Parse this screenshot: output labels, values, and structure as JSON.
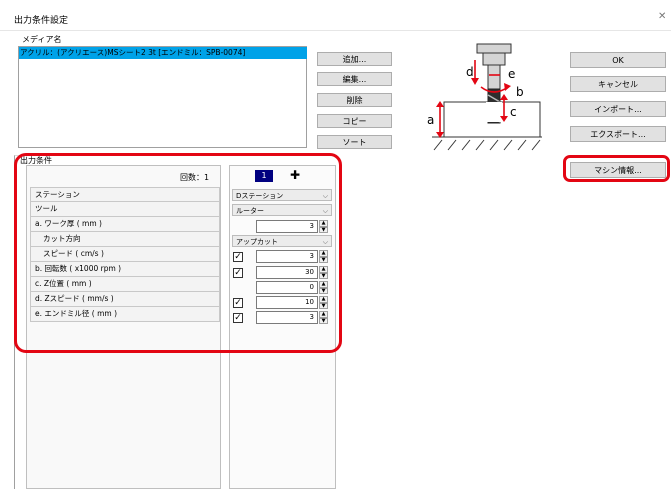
{
  "window": {
    "title": "出力条件設定",
    "close_glyph": "✕"
  },
  "media": {
    "label": "メディア名",
    "items": [
      "アクリル：(アクリエース)MSシート2 3t [エンドミル：SPB-0074]"
    ]
  },
  "buttons": {
    "add": "追加...",
    "edit": "編集...",
    "delete": "削除",
    "copy": "コピー",
    "sort": "ソート",
    "ok": "OK",
    "cancel": "キャンセル",
    "import": "インポート...",
    "export": "エクスポート...",
    "machine_info": "マシン情報..."
  },
  "diagram": {
    "icon": "end-mill-cutting-diagram-icon",
    "labels": {
      "a": "a",
      "b": "b",
      "c": "c",
      "d": "d",
      "e": "e"
    },
    "colors": {
      "arrows": "#e30613"
    }
  },
  "output": {
    "label": "出力条件",
    "count_label": "回数：1",
    "tab_number": "1",
    "add_glyph": "✚",
    "rows": [
      {
        "label": "ステーション"
      },
      {
        "label": "ツール"
      },
      {
        "label": "a. ワーク厚 ( mm )"
      },
      {
        "label": "カット方向"
      },
      {
        "label": "スピード ( cm/s )"
      },
      {
        "label": "b. 回転数 ( x1000  rpm )"
      },
      {
        "label": "c. Z位置 ( mm )"
      },
      {
        "label": "d. Zスピード ( mm/s )"
      },
      {
        "label": "e. エンドミル径 ( mm )"
      }
    ],
    "values": {
      "station": "Dステーション",
      "tool": "ルーター",
      "work_thickness": "3",
      "cut_direction": "アップカット",
      "speed": "3",
      "rotation": "30",
      "z_position": "0",
      "z_speed": "10",
      "endmill_diameter": "3"
    },
    "checks": {
      "speed": true,
      "rotation": true,
      "z_speed": true,
      "endmill_diameter": true
    },
    "check_glyph": "✓",
    "combo_glyph": "⌵",
    "spin_up": "▲",
    "spin_down": "▼"
  },
  "colors": {
    "highlight": "#e30613",
    "selection": "#00a2e8",
    "tab": "#000080"
  }
}
